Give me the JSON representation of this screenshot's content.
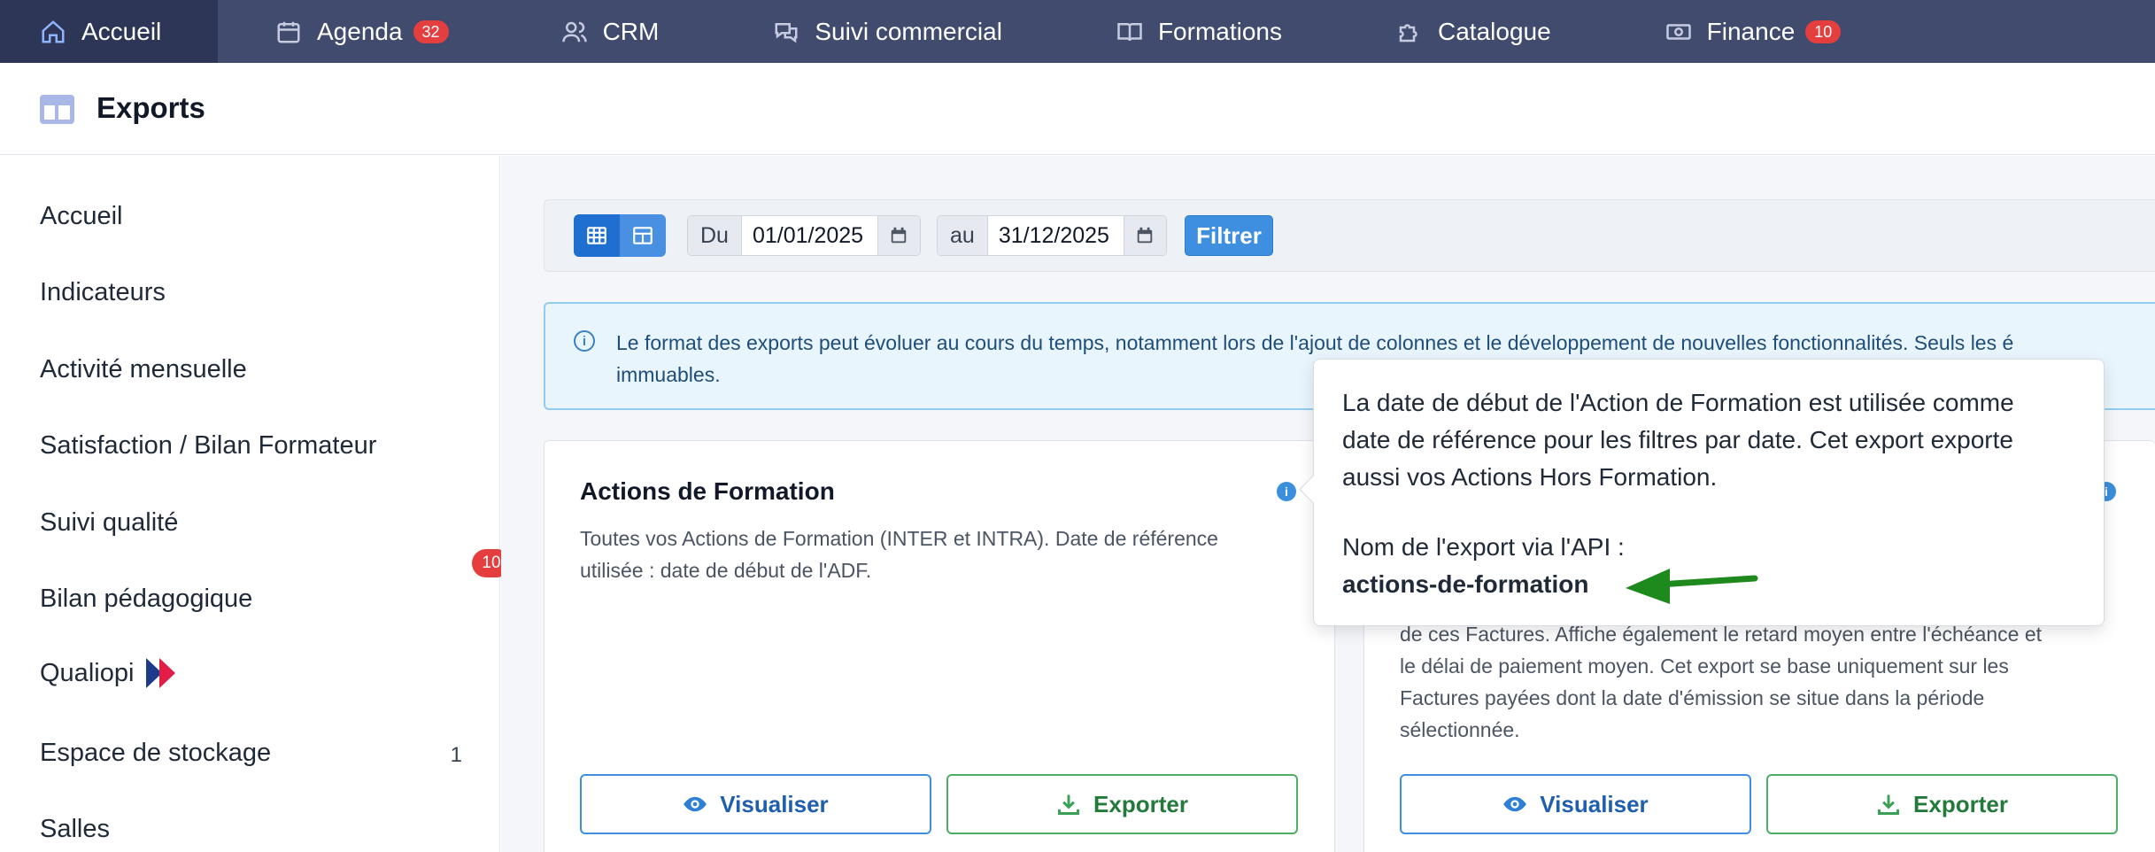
{
  "nav": {
    "items": [
      {
        "label": "Accueil",
        "icon": "home-icon"
      },
      {
        "label": "Agenda",
        "icon": "calendar-icon",
        "badge": "32"
      },
      {
        "label": "CRM",
        "icon": "users-icon"
      },
      {
        "label": "Suivi commercial",
        "icon": "chat-icon"
      },
      {
        "label": "Formations",
        "icon": "book-icon"
      },
      {
        "label": "Catalogue",
        "icon": "puzzle-icon"
      },
      {
        "label": "Finance",
        "icon": "money-icon",
        "badge": "10"
      }
    ]
  },
  "page": {
    "title": "Exports"
  },
  "sidebar": {
    "items": [
      {
        "label": "Accueil"
      },
      {
        "label": "Indicateurs"
      },
      {
        "label": "Activité mensuelle"
      },
      {
        "label": "Satisfaction / Bilan Formateur"
      },
      {
        "label": "Suivi qualité"
      },
      {
        "label": "Bilan pédagogique"
      },
      {
        "label": "Qualiopi"
      },
      {
        "label": "Espace de stockage",
        "count": "1"
      },
      {
        "label": "Salles"
      }
    ],
    "badge": "10"
  },
  "filters": {
    "from_prefix": "Du",
    "from_value": "01/01/2025",
    "to_prefix": "au",
    "to_value": "31/12/2025",
    "submit_label": "Filtrer"
  },
  "alert": {
    "line1": "Le format des exports peut évoluer au cours du temps, notamment lors de l'ajout de colonnes et le développement de nouvelles fonctionnalités. Seuls les é",
    "line2": "immuables."
  },
  "cards": [
    {
      "title": "Actions de Formation",
      "desc_line1": "Toutes vos Actions de Formation (INTER et INTRA). Date de référence",
      "desc_line2": "utilisée : date de début de l'ADF.",
      "view_label": "Visualiser",
      "export_label": "Exporter"
    },
    {
      "desc_line1": "de ces Factures. Affiche également le retard moyen entre l'échéance et",
      "desc_line2": "le délai de paiement moyen. Cet export se base uniquement sur les",
      "desc_line3": "Factures payées dont la date d'émission se situe dans la période",
      "desc_line4": "sélectionnée.",
      "view_label": "Visualiser",
      "export_label": "Exporter"
    }
  ],
  "tooltip": {
    "line1": "La date de début de l'Action de Formation est utilisée comme",
    "line2": "date de référence pour les filtres par date. Cet export exporte",
    "line3": "aussi vos Actions Hors Formation.",
    "api_label": "Nom de l'export via l'API :",
    "api_name": "actions-de-formation"
  },
  "colors": {
    "nav_bg": "#404b6e",
    "nav_active_bg": "#2d3656",
    "primary": "#3f8fe0",
    "success": "#4caf63",
    "danger": "#e53e3e",
    "arrow": "#1e8a1e"
  }
}
